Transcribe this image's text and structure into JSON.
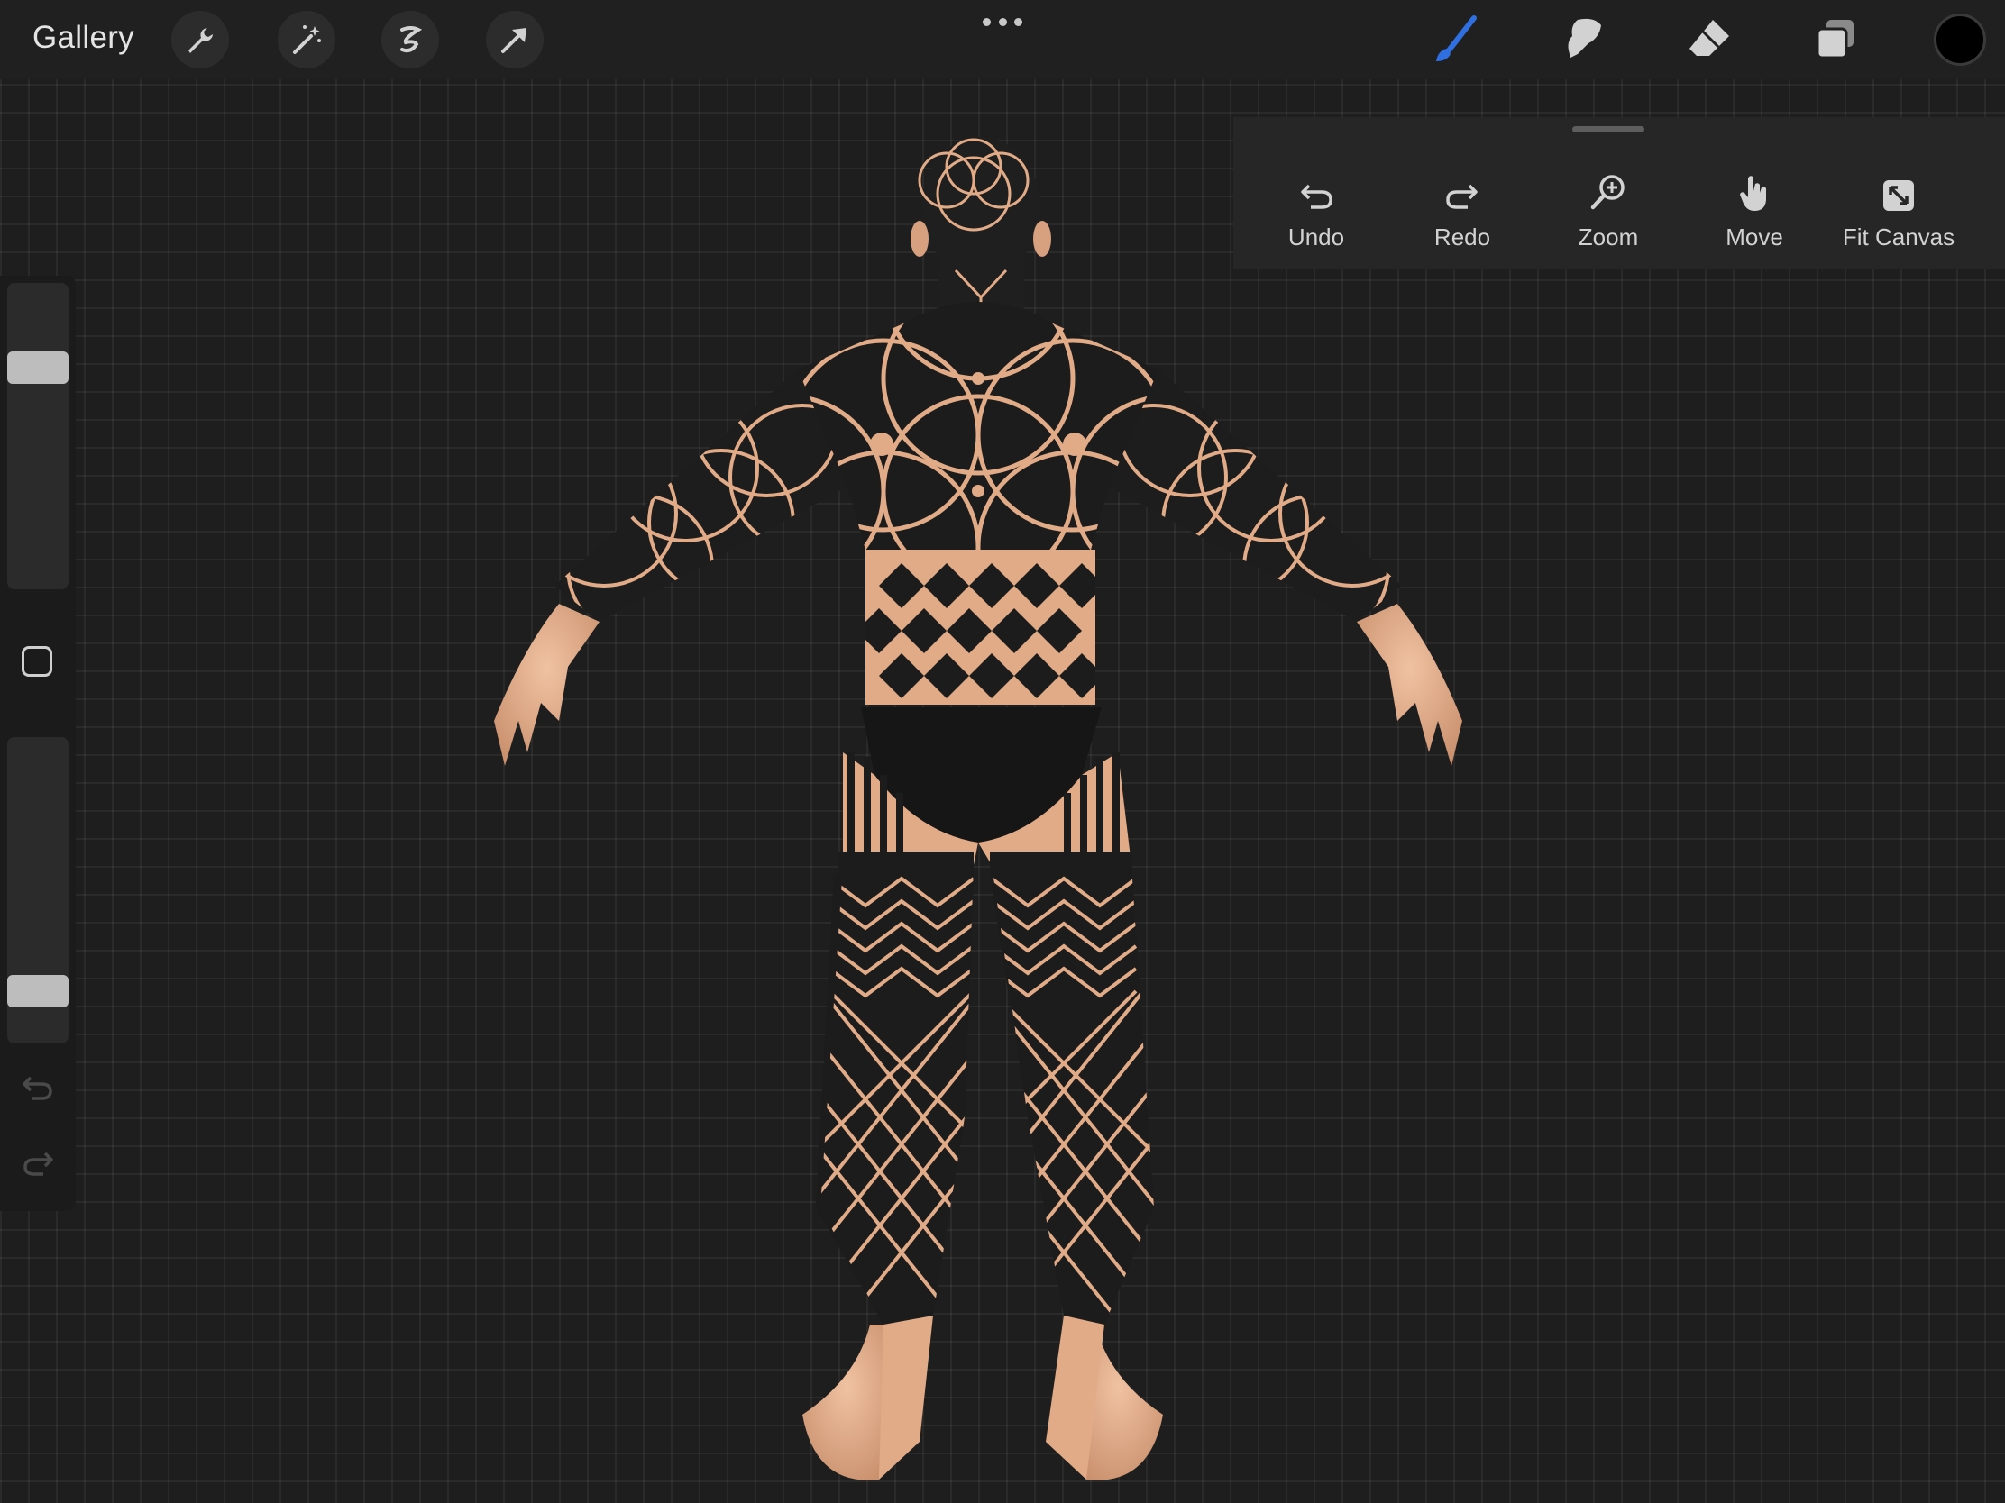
{
  "topbar": {
    "gallery_label": "Gallery",
    "left_tools": [
      "wrench-icon",
      "magic-wand-icon",
      "selection-icon",
      "transform-arrow-icon"
    ],
    "right_tools": [
      "brush-icon",
      "smudge-icon",
      "eraser-icon",
      "layers-icon"
    ],
    "active_tool": "brush-icon",
    "current_color": "#000000"
  },
  "view_panel": {
    "undo_label": "Undo",
    "redo_label": "Redo",
    "zoom_label": "Zoom",
    "move_label": "Move",
    "fit_canvas_label": "Fit Canvas"
  },
  "sidebar": {
    "brush_size_level": 0.75,
    "opacity_level": 0.13
  },
  "colors": {
    "accent_blue": "#2f6fe0",
    "skin": "#e9b494",
    "tattoo_ink": "#1c1c1c",
    "background": "#1e1e1e"
  }
}
